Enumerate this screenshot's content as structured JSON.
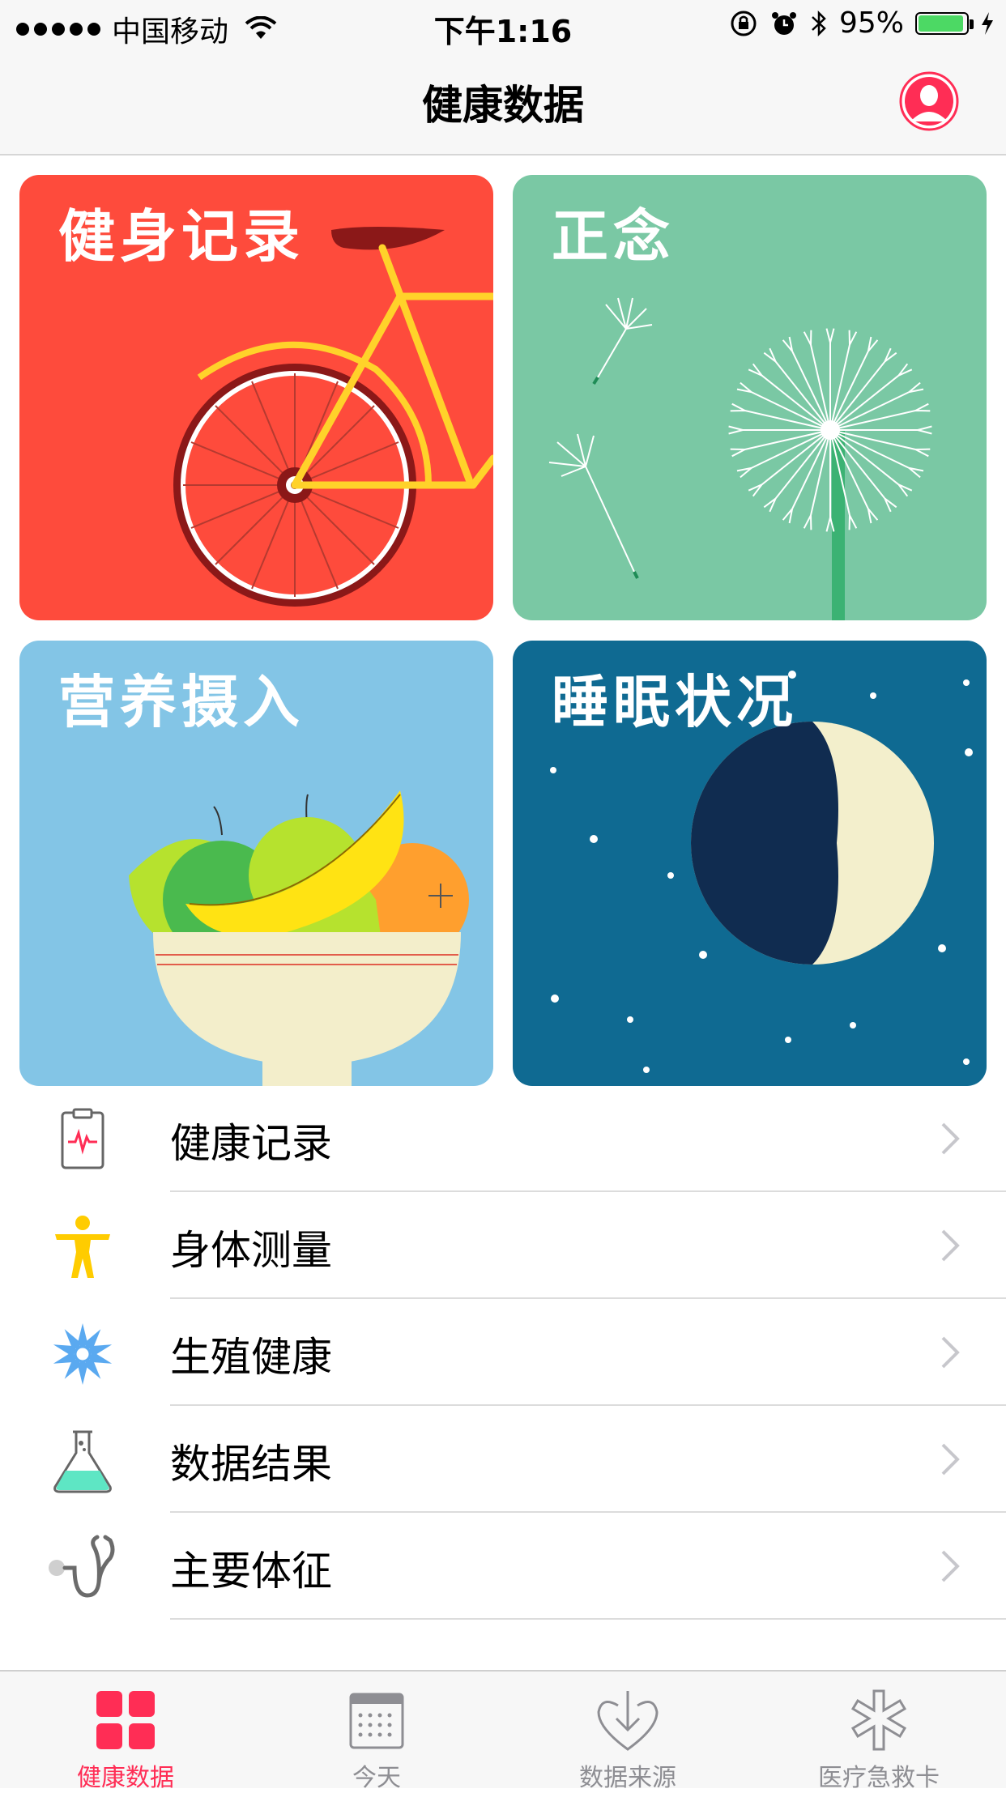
{
  "status_bar": {
    "carrier": "中国移动",
    "time": "下午1:16",
    "battery": "95%",
    "battery_level": 0.95
  },
  "nav": {
    "title": "健康数据",
    "profile_icon": "profile-icon"
  },
  "tiles": [
    {
      "title": "健身记录",
      "color": "#fe4b3c"
    },
    {
      "title": "正念",
      "color": "#7ac8a4"
    },
    {
      "title": "营养摄入",
      "color": "#83c5e6"
    },
    {
      "title": "睡眠状况",
      "color": "#0f6a92"
    }
  ],
  "list": [
    {
      "label": "健康记录",
      "icon": "health-records-icon"
    },
    {
      "label": "身体测量",
      "icon": "body-measurements-icon"
    },
    {
      "label": "生殖健康",
      "icon": "reproductive-health-icon"
    },
    {
      "label": "数据结果",
      "icon": "results-icon"
    },
    {
      "label": "主要体征",
      "icon": "vitals-icon"
    }
  ],
  "tabs": [
    {
      "label": "健康数据",
      "icon": "grid-icon",
      "active": true
    },
    {
      "label": "今天",
      "icon": "calendar-icon",
      "active": false
    },
    {
      "label": "数据来源",
      "icon": "download-heart-icon",
      "active": false
    },
    {
      "label": "医疗急救卡",
      "icon": "asterisk-icon",
      "active": false
    }
  ],
  "colors": {
    "accent": "#ff2d55",
    "inactive": "#8e8e93"
  }
}
